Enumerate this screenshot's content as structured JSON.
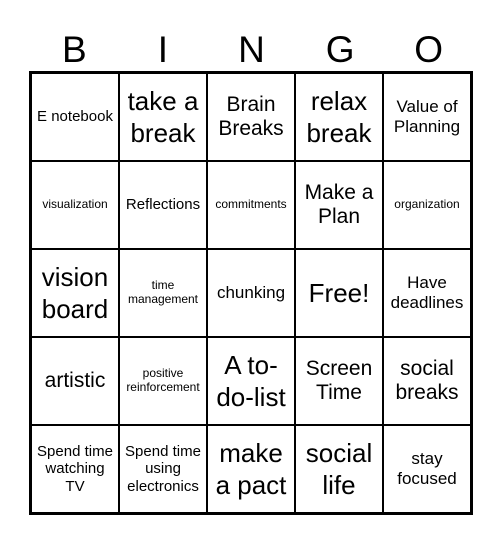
{
  "header": [
    "B",
    "I",
    "N",
    "G",
    "O"
  ],
  "cells": [
    [
      "E notebook",
      "take a break",
      "Brain Breaks",
      "relax break",
      "Value of Planning"
    ],
    [
      "visualization",
      "Reflections",
      "commitments",
      "Make a Plan",
      "organization"
    ],
    [
      "vision board",
      "time management",
      "chunking",
      "Free!",
      "Have deadlines"
    ],
    [
      "artistic",
      "positive reinforcement",
      "A to-do-list",
      "Screen Time",
      "social breaks"
    ],
    [
      "Spend time watching TV",
      "Spend time using electronics",
      "make a pact",
      "social life",
      "stay focused"
    ]
  ]
}
